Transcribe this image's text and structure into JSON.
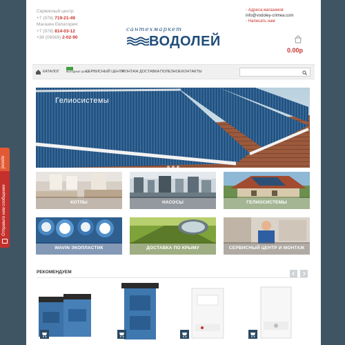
{
  "feedback": {
    "logo_text": "jivosite",
    "label": "Отправьте нам сообщение"
  },
  "header": {
    "service_center_label": "Сервисный центр:",
    "service_prefix": "+7 (978)",
    "service_number": "719-21-49",
    "store_label": "Магазин Евпатория:",
    "store_prefix": "+7 (978)",
    "store_number": "814-03-12",
    "store_prefix_2": "+38 (06569)",
    "store_number_2": "2-02-90",
    "logo_tagline": "сантехмаркет",
    "logo_name": "ВОДОЛЕЙ",
    "store_addresses_link": "Адреса магазинов",
    "email": "info@vodoley-crimea.com",
    "write_us_link": "Написать нам",
    "cart_total": "0.00р"
  },
  "nav": {
    "items": [
      "КАТАЛОГ",
      "СЕРВИСНЫЙ ЦЕНТР",
      "МОНТАЖ",
      "ДОСТАВКА",
      "ПОЛЕЗНОЕ",
      "КОНТАКТЫ"
    ],
    "badge_text": "ВЫГОДНЫЕ ЦЕНЫ",
    "search_placeholder": ""
  },
  "banner": {
    "title": "Гелиосистемы",
    "slide_count": 3,
    "active_slide": 1
  },
  "categories": [
    {
      "label": "КОТЛЫ"
    },
    {
      "label": "НАСОСЫ"
    },
    {
      "label": "ГЕЛИОСИСТЕМЫ"
    },
    {
      "label": "WAVIN ЭКОПЛАСТИК"
    },
    {
      "label": "ДОСТАВКА ПО КРЫМУ"
    },
    {
      "label": "СЕРВИСНЫЙ ЦЕНТР И МОНТАЖ"
    }
  ],
  "recommended": {
    "title": "РЕКОМЕНДУЕМ",
    "products": [
      {
        "type": "blue-boiler-pair"
      },
      {
        "type": "blue-boiler-tall"
      },
      {
        "type": "white-gas-boiler"
      },
      {
        "type": "white-gas-boiler-2"
      }
    ]
  },
  "colors": {
    "accent_red": "#c8322d",
    "logo_blue": "#1f4d7a",
    "page_background": "#3f5563",
    "cart_button": "#2a4a64"
  }
}
